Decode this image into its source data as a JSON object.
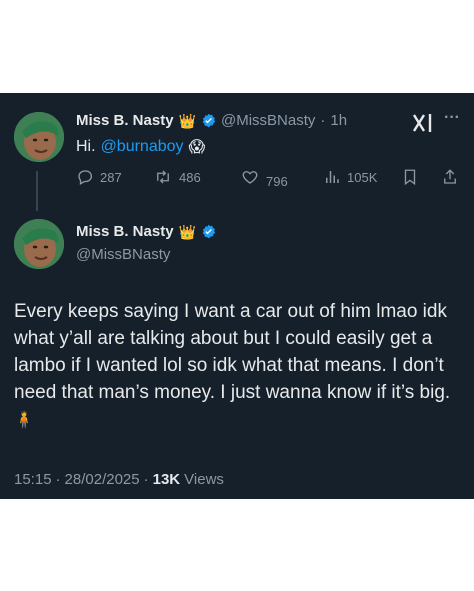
{
  "reply": {
    "name": "Miss B. Nasty",
    "name_emoji": "👑",
    "handle": "@MissBNasty",
    "separator": "·",
    "time": "1h",
    "text_prefix": "Hi.",
    "mention": "@burnaboy",
    "text_emoji": "😱",
    "more_label": "···",
    "actions": {
      "replies": "287",
      "reposts": "486",
      "likes": "796",
      "views": "105K"
    }
  },
  "main": {
    "name": "Miss B. Nasty",
    "name_emoji": "👑",
    "handle": "@MissBNasty",
    "text": "Every keeps saying I want a car out of him lmao idk what y’all are talking about but I could easily get a lambo if I wanted lol so idk what that means. I don’t need that man’s money. I just wanna know if it’s big.",
    "text_emoji": "🧍",
    "time": "15:15",
    "separator": "·",
    "date": "28/02/2025",
    "separator2": "·",
    "views_count": "13K",
    "views_label": "Views"
  },
  "colors": {
    "background": "#15202b",
    "text": "#e7e9ea",
    "muted": "#8b98a5",
    "accent": "#1d9bf0"
  },
  "icons": [
    "reply-icon",
    "repost-icon",
    "like-icon",
    "views-icon",
    "bookmark-icon",
    "share-icon",
    "verified-icon",
    "grok-icon",
    "more-icon"
  ]
}
